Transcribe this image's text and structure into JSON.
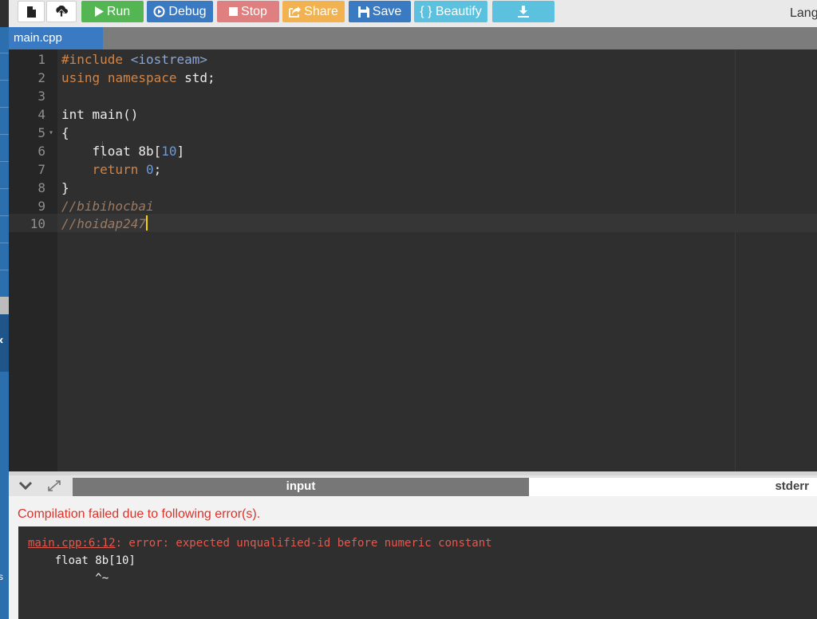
{
  "toolbar": {
    "run_label": "Run",
    "debug_label": "Debug",
    "stop_label": "Stop",
    "share_label": "Share",
    "save_label": "Save",
    "beautify_label": "{ } Beautify",
    "language_label": "Lang"
  },
  "file_tabs": [
    {
      "label": "main.cpp"
    }
  ],
  "editor": {
    "line_numbers": [
      "1",
      "2",
      "3",
      "4",
      "5",
      "6",
      "7",
      "8",
      "9",
      "10"
    ],
    "lines": [
      {
        "pp": "#include",
        "hdr": " <iostream>"
      },
      {
        "kw1": "using",
        "kw2": "namespace",
        "rest": " std;"
      },
      {
        "text": ""
      },
      {
        "text": "int main()"
      },
      {
        "text": "{"
      },
      {
        "pre": "    float 8b[",
        "num": "10",
        "post": "]"
      },
      {
        "kw": "return",
        "sp": " ",
        "num": "0",
        "post": ";"
      },
      {
        "text": "}"
      },
      {
        "comment": "//bibihocbai"
      },
      {
        "comment": "//hoidap247"
      }
    ],
    "active_line": "10"
  },
  "panel": {
    "tab_input": "input",
    "tab_stderr": "stderr"
  },
  "output": {
    "compile_message": "Compilation failed due to following error(s).",
    "error_location": "main.cpp:6:12",
    "error_message": ": error: expected unqualified-id before numeric constant",
    "code_line": "    float 8b[10]",
    "caret_line": "          ^~"
  },
  "colors": {
    "run": "#54b553",
    "debug": "#3a7ac2",
    "stop": "#e07f7f",
    "share": "#f1b24f",
    "save": "#3a7ac2",
    "beautify": "#5cc1df",
    "error_text": "#d9342b"
  },
  "icons": [
    "new-file-icon",
    "upload-icon",
    "play-icon",
    "debug-circle-icon",
    "stop-square-icon",
    "share-icon",
    "floppy-icon",
    "download-icon",
    "chevron-down-icon",
    "expand-arrows-icon",
    "chevron-left-icon"
  ]
}
